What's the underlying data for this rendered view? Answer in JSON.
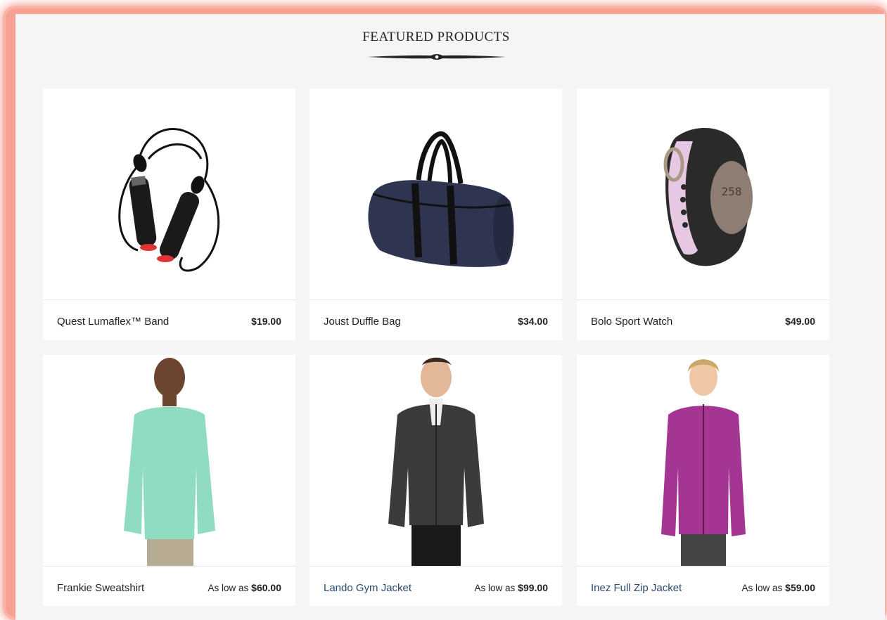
{
  "section": {
    "title": "FEATURED PRODUCTS"
  },
  "products": [
    {
      "name": "Quest Lumaflex™ Band",
      "price_label": "",
      "price": "$19.00",
      "image_icon": "jump-rope-icon"
    },
    {
      "name": "Joust Duffle Bag",
      "price_label": "",
      "price": "$34.00",
      "image_icon": "duffle-bag-icon"
    },
    {
      "name": "Bolo Sport Watch",
      "price_label": "",
      "price": "$49.00",
      "image_icon": "sport-watch-icon"
    },
    {
      "name": "Frankie Sweatshirt",
      "price_label": "As low as",
      "price": "$60.00",
      "image_icon": "sweatshirt-model-icon"
    },
    {
      "name": "Lando Gym Jacket",
      "price_label": "As low as",
      "price": "$99.00",
      "image_icon": "gym-jacket-model-icon"
    },
    {
      "name": "Inez Full Zip Jacket",
      "price_label": "As low as",
      "price": "$59.00",
      "image_icon": "zip-jacket-model-icon"
    }
  ],
  "colors": {
    "frame": "#f6a193",
    "link": "#2d4a6e"
  }
}
